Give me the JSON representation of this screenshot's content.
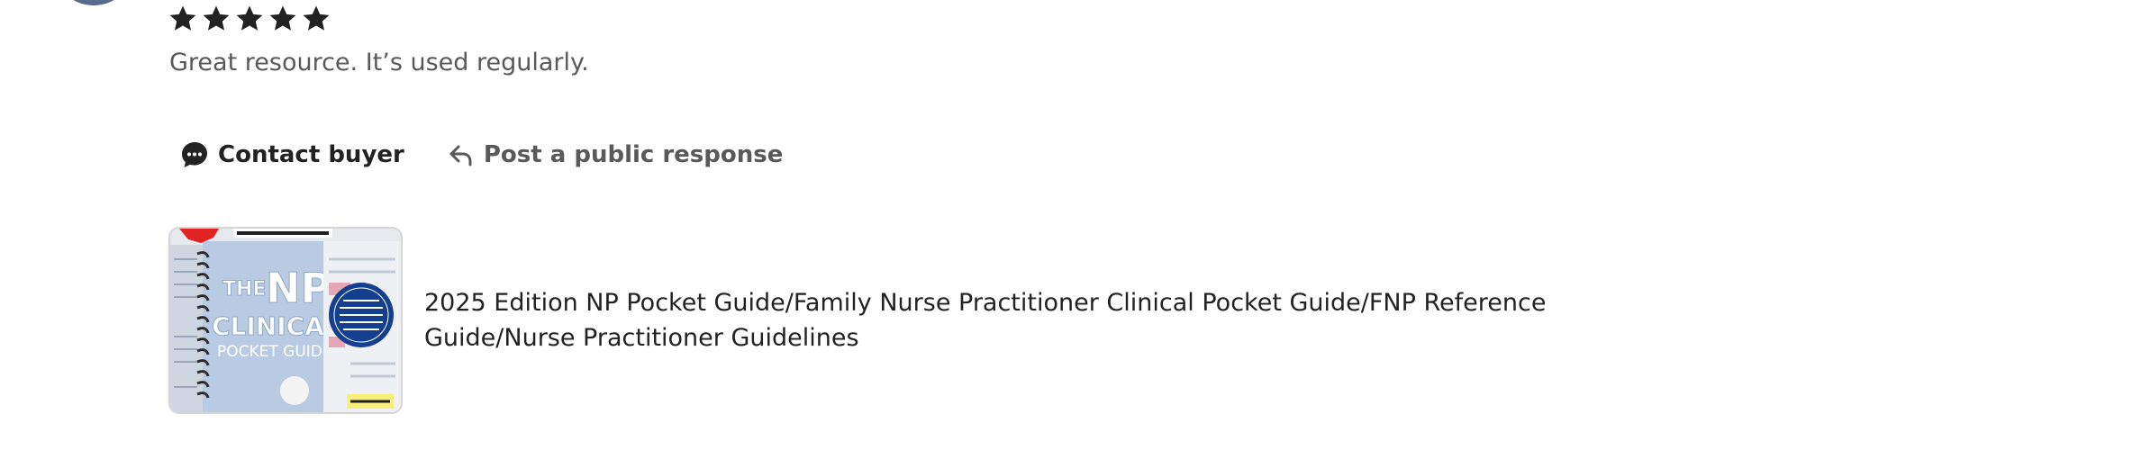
{
  "review": {
    "rating": 5,
    "rating_max": 5,
    "text": "Great resource. It’s used regularly."
  },
  "actions": {
    "contact_label": "Contact buyer",
    "respond_label": "Post a public response"
  },
  "listing": {
    "title": "2025 Edition NP Pocket Guide/Family Nurse Practitioner Clinical Pocket Guide/FNP Reference Guide/Nurse Practitioner Guidelines"
  },
  "colors": {
    "star": "#222222",
    "secondary_text": "#595959"
  },
  "icons": {
    "contact": "chat-bubble-icon",
    "respond": "reply-arrow-icon"
  }
}
